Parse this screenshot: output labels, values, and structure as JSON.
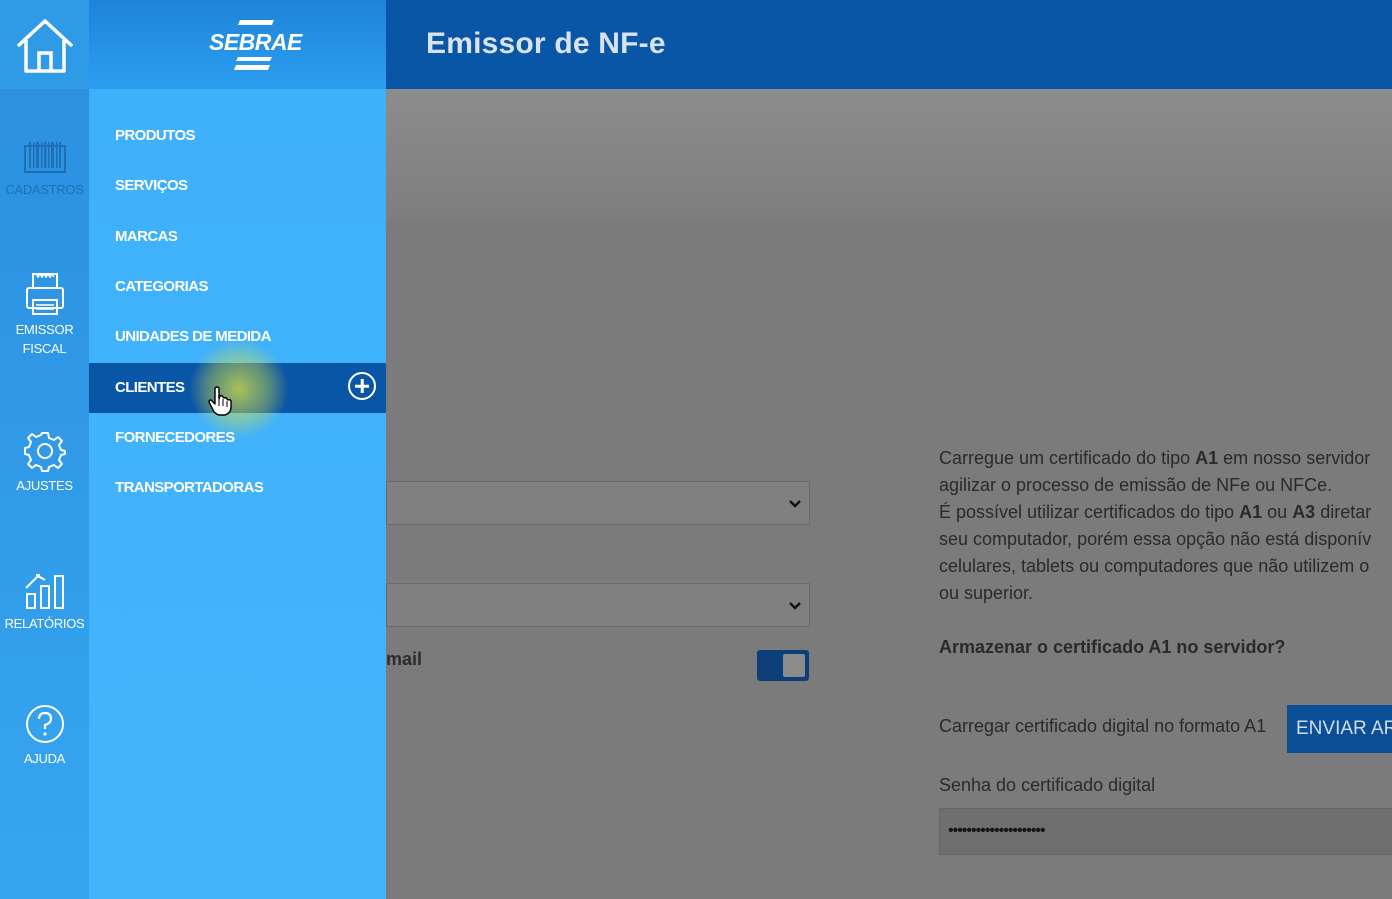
{
  "rail": {
    "items": [
      {
        "label": "CADASTROS",
        "icon": "barcode-icon"
      },
      {
        "label": "EMISSOR FISCAL",
        "label_line1": "EMISSOR",
        "label_line2": "FISCAL",
        "icon": "printer-icon"
      },
      {
        "label": "AJUSTES",
        "icon": "gear-icon"
      },
      {
        "label": "RELATÓRIOS",
        "icon": "bar-chart-icon"
      },
      {
        "label": "AJUDA",
        "icon": "help-icon"
      }
    ]
  },
  "header": {
    "logo_text": "SEBRAE",
    "title": "Emissor de NF-e"
  },
  "submenu": {
    "items": [
      {
        "label": "PRODUTOS"
      },
      {
        "label": "SERVIÇOS"
      },
      {
        "label": "MARCAS"
      },
      {
        "label": "CATEGORIAS"
      },
      {
        "label": "UNIDADES DE MEDIDA"
      },
      {
        "label": "CLIENTES",
        "active": true
      },
      {
        "label": "FORNECEDORES"
      },
      {
        "label": "TRANSPORTADORAS"
      }
    ]
  },
  "form": {
    "email_label": "mail",
    "email_toggle_on": true
  },
  "certificate": {
    "info_line1_a": "Carregue um certificado do tipo ",
    "info_line1_b": "A1",
    "info_line1_c": " em nosso servidor",
    "info_line2": "agilizar o processo de emissão de NFe ou NFCe.",
    "info_line3_a": "É possível utilizar certificados do tipo ",
    "info_line3_b": "A1",
    "info_line3_c": " ou ",
    "info_line3_d": "A3",
    "info_line3_e": " diretar",
    "info_line4": "seu computador, porém essa opção não está disponív",
    "info_line5": "celulares, tablets ou computadores que não utilizem o",
    "info_line6": "ou superior.",
    "question": "Armazenar o certificado A1 no servidor?",
    "upload_label": "Carregar certificado digital no formato A1",
    "upload_button": "ENVIAR AR",
    "password_label": "Senha do certificado digital",
    "password_value": "•••••••••••••••••••••"
  },
  "colors": {
    "header_dark": "#0a56a6",
    "menu_light": "#44b4fc",
    "active_item": "#0a56a6"
  }
}
